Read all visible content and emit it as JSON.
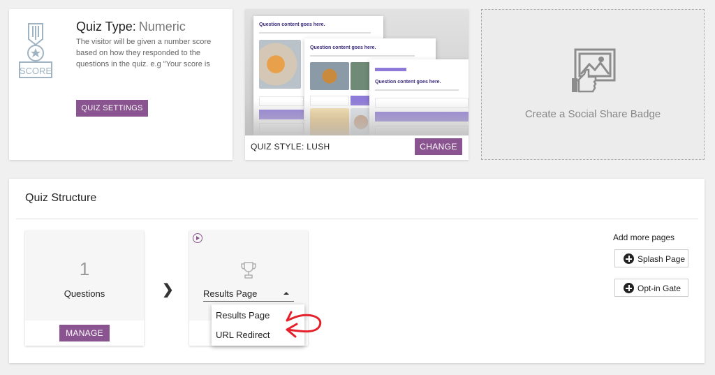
{
  "quiz_type": {
    "title_label": "Quiz Type:",
    "title_value": "Numeric",
    "description": "The visitor will be given a number score based on how they responded to the questions in the quiz. e.g \"Your score is",
    "icon": "score-badge-icon",
    "icon_text": "SCORE",
    "settings_button": "QUIZ SETTINGS"
  },
  "quiz_style": {
    "preview_title_1": "Question content goes here.",
    "preview_title_2": "Question content goes here.",
    "preview_title_3": "Question content goes here.",
    "label": "QUIZ STYLE: LUSH",
    "change_button": "CHANGE"
  },
  "social_badge": {
    "icon": "image-thumbs-up-icon",
    "label": "Create a Social Share Badge"
  },
  "structure": {
    "title": "Quiz Structure",
    "questions_card": {
      "count": "1",
      "label": "Questions",
      "manage_button": "MANAGE"
    },
    "results_card": {
      "selected": "Results Page",
      "options": [
        "Results Page",
        "URL Redirect"
      ]
    },
    "add_more_pages": {
      "label": "Add more pages",
      "splash_button": "Splash Page",
      "optin_button": "Opt-in Gate"
    }
  },
  "colors": {
    "accent": "#8a5491",
    "preview_selected": "#8e7ad8",
    "annotation_red": "#e5202a"
  }
}
